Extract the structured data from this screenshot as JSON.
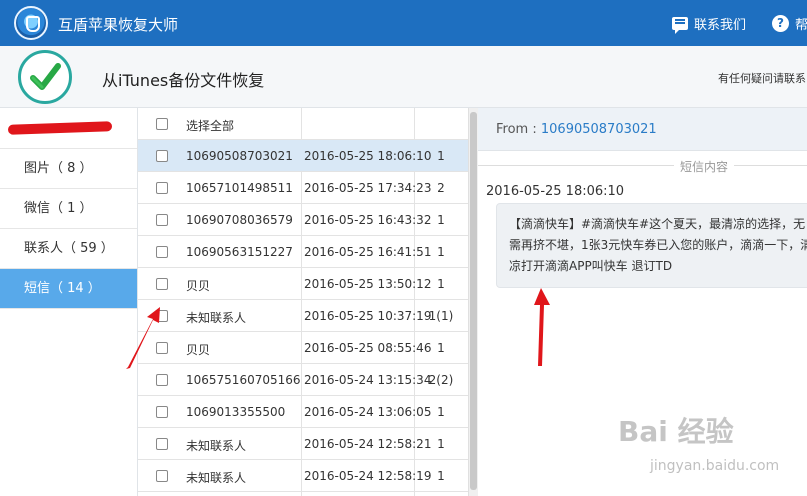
{
  "titlebar": {
    "app_title": "互盾苹果恢复大师",
    "contact_label": "联系我们",
    "help_label": "帮",
    "logo_icon": "shield-logo-icon"
  },
  "header": {
    "title": "从iTunes备份文件恢复",
    "note": "有任何疑问请联系"
  },
  "sidebar": {
    "items": [
      {
        "label": "图片（ 8 ）"
      },
      {
        "label": "微信（ 1 ）"
      },
      {
        "label": "联系人（ 59 ）"
      },
      {
        "label": "短信（ 14 ）"
      }
    ],
    "active_index": 3
  },
  "list": {
    "select_all_label": "选择全部",
    "rows": [
      {
        "name": "10690508703021",
        "time": "2016-05-25 18:06:10",
        "count": "1"
      },
      {
        "name": "10657101498511",
        "time": "2016-05-25 17:34:23",
        "count": "2"
      },
      {
        "name": "10690708036579",
        "time": "2016-05-25 16:43:32",
        "count": "1"
      },
      {
        "name": "10690563151227",
        "time": "2016-05-25 16:41:51",
        "count": "1"
      },
      {
        "name": "贝贝",
        "time": "2016-05-25 13:50:12",
        "count": "1"
      },
      {
        "name": "未知联系人",
        "time": "2016-05-25 10:37:19",
        "count": "1(1)"
      },
      {
        "name": "贝贝",
        "time": "2016-05-25 08:55:46",
        "count": "1"
      },
      {
        "name": "106575160705166",
        "time": "2016-05-24 13:15:34",
        "count": "2(2)"
      },
      {
        "name": "1069013355500",
        "time": "2016-05-24 13:06:05",
        "count": "1"
      },
      {
        "name": "未知联系人",
        "time": "2016-05-24 12:58:21",
        "count": "1"
      },
      {
        "name": "未知联系人",
        "time": "2016-05-24 12:58:19",
        "count": "1"
      }
    ]
  },
  "detail": {
    "from_label": "From :",
    "from_number": "10690508703021",
    "section_label": "短信内容",
    "message_time": "2016-05-25 18:06:10",
    "message_text": "【滴滴快车】#滴滴快车#这个夏天，最清凉的选择，无需再挤不堪，1张3元快车券已入您的账户，滴滴一下，清凉打开滴滴APP叫快车 退订TD"
  },
  "watermark": {
    "brand": "Bai 经验",
    "url": "jingyan.baidu.com"
  },
  "colors": {
    "titlebar": "#1e6fc0",
    "active_tab": "#58a9ea",
    "selected_row": "#d9e8f6",
    "link": "#2a7cc7",
    "annotation": "#e0161b"
  }
}
